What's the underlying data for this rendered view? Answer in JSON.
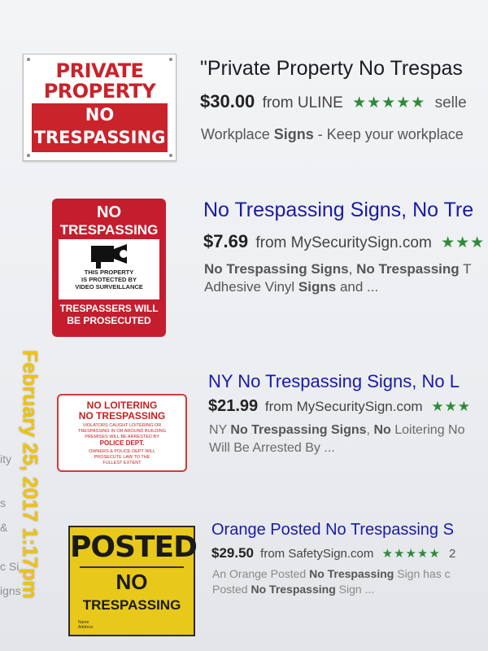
{
  "overlay": {
    "timestamp": "February 25, 2017 1:17pm"
  },
  "sidebar_fragments": [
    "ity",
    "s",
    "&",
    "c Si",
    "igns"
  ],
  "results": [
    {
      "title": "\"Private Property No Trespas",
      "price": "$30.00",
      "from": "from ULINE",
      "stars": "★★★★★",
      "extra": "selle",
      "snippet": [
        [
          "Workplace ",
          "Signs",
          " - Keep your workplace"
        ]
      ],
      "sign": {
        "lines_top": [
          "PRIVATE",
          "PROPERTY"
        ],
        "lines_band": [
          "NO",
          "TRESPASSING"
        ]
      }
    },
    {
      "title": "No Trespassing Signs, No Tre",
      "price": "$7.69",
      "from": "from MySecuritySign.com",
      "stars": "★★★",
      "snippet": [
        [
          "No Trespassing Signs",
          ", ",
          "No Trespassing",
          " T"
        ],
        [
          "Adhesive Vinyl ",
          "Signs",
          " and ..."
        ]
      ],
      "sign": {
        "top": [
          "NO",
          "TRESPASSING"
        ],
        "small": [
          "THIS PROPERTY",
          "IS PROTECTED BY",
          "VIDEO SURVEILLANCE"
        ],
        "bottom": [
          "TRESPASSERS WILL",
          "BE PROSECUTED"
        ]
      }
    },
    {
      "title": "NY No Trespassing Signs, No L",
      "price": "$21.99",
      "from": "from MySecuritySign.com",
      "stars": "★★★",
      "snippet": [
        [
          "NY ",
          "No Trespassing Signs",
          ", ",
          "No",
          " Loitering No"
        ],
        [
          "Will Be Arrested By ..."
        ]
      ],
      "sign": {
        "head": [
          "NO LOITERING",
          "NO TRESPASSING"
        ],
        "fine": [
          "VIOLATORS CAUGHT LOITERING OR",
          "TRESPASSING IN OR AROUND BUILDING",
          "PREMISES WILL BE ARRESTED BY"
        ],
        "pd": "POLICE DEPT.",
        "fine2": [
          "OWNERS & POLICE DEPT WILL",
          "PROSECUTE LAW TO THE",
          "FULLEST EXTENT"
        ]
      }
    },
    {
      "title": "Orange Posted No Trespassing S",
      "price": "$29.50",
      "from": "from SafetySign.com",
      "stars": "★★★★★",
      "extra": "2",
      "snippet": [
        [
          "An Orange Posted ",
          "No Trespassing",
          " Sign has c"
        ],
        [
          "Posted ",
          "No Trespassing",
          " Sign ..."
        ]
      ],
      "sign": {
        "posted": "POSTED",
        "no": "NO",
        "tr": "TRESPASSING",
        "lines": [
          "Name",
          "Address"
        ]
      }
    }
  ]
}
